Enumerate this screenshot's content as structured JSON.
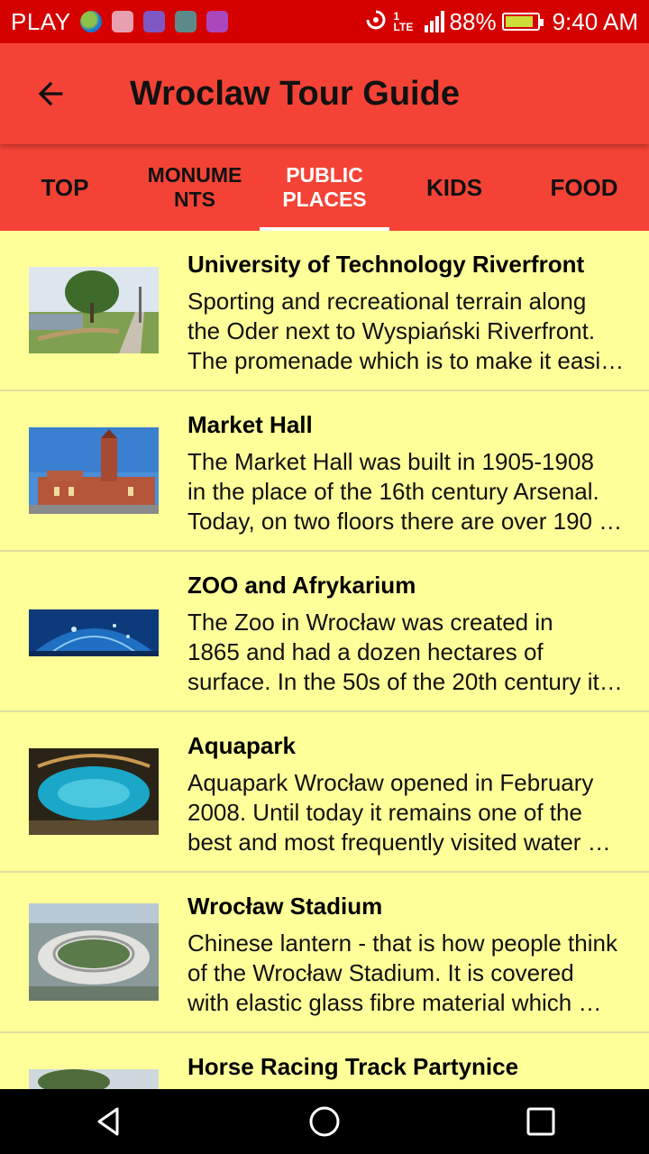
{
  "status_bar": {
    "carrier": "PLAY",
    "network": "1 LTE",
    "battery_percent": "88%",
    "battery_level": 0.88,
    "time": "9:40 AM",
    "notification_icons": [
      "globe-icon",
      "mail-icon",
      "sync-app-icon",
      "android-icon",
      "gallery-icon"
    ]
  },
  "app_bar": {
    "title": "Wroclaw Tour Guide",
    "back_icon": "arrow-back-icon"
  },
  "tabs": [
    {
      "label": "TOP",
      "selected": false
    },
    {
      "label": "MONUMENTS",
      "selected": false
    },
    {
      "label": "PUBLIC PLACES",
      "selected": true
    },
    {
      "label": "KIDS",
      "selected": false
    },
    {
      "label": "FOOD",
      "selected": false
    }
  ],
  "places": [
    {
      "title": "University of Technology Riverfront",
      "lines": [
        "Sporting and recreational terrain along",
        "the Oder next to Wyspiański Riverfront.",
        "The promenade which is to make it easi…"
      ],
      "image": "riverfront-park-image"
    },
    {
      "title": "Market Hall",
      "lines": [
        "The Market Hall was built in 1905-1908",
        "in the place of the 16th century Arsenal.",
        "Today, on two floors there are over 190 …"
      ],
      "image": "market-hall-image"
    },
    {
      "title": "ZOO and Afrykarium",
      "lines": [
        "The Zoo in Wrocław was created in",
        "1865 and had a dozen hectares of",
        "surface. In the 50s of the 20th century it…"
      ],
      "image": "aquarium-tunnel-image"
    },
    {
      "title": "Aquapark",
      "lines": [
        "Aquapark Wrocław opened in February",
        "2008. Until today it remains one of the",
        "best and most frequently visited water …"
      ],
      "image": "aquapark-pool-image"
    },
    {
      "title": "Wrocław Stadium",
      "lines": [
        "Chinese lantern - that is how people think",
        "of the Wrocław Stadium. It is covered",
        "with elastic glass fibre material which …"
      ],
      "image": "stadium-aerial-image"
    },
    {
      "title": "Horse Racing Track Partynice",
      "lines": [],
      "image": "racing-track-image"
    }
  ],
  "nav_bar": {
    "back": "nav-back-icon",
    "home": "nav-home-icon",
    "recents": "nav-recents-icon"
  },
  "colors": {
    "status_bar": "#D50000",
    "app_bar": "#F44336",
    "list_background": "#FFFF99",
    "selected_tab_text": "#FFFFFF"
  }
}
